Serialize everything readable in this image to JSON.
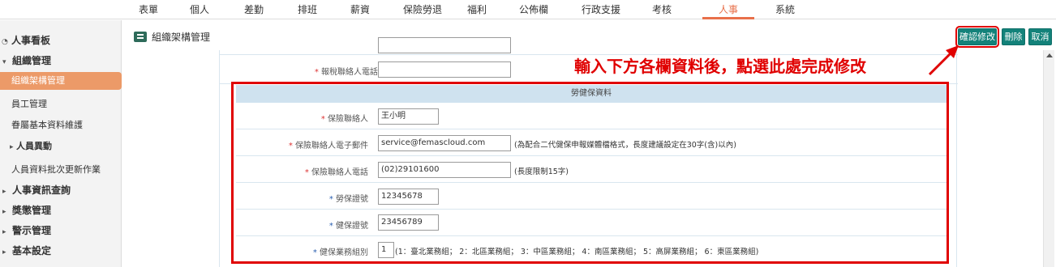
{
  "topnav": {
    "items": [
      "表單",
      "個人",
      "差勤",
      "排班",
      "薪資",
      "保險勞退",
      "福利",
      "公佈欄",
      "行政支援",
      "考核",
      "人事",
      "系統"
    ],
    "active": "人事"
  },
  "sidebar": {
    "hr_board": "人事看板",
    "org_manage": "組織管理",
    "org_structure": "組織架構管理",
    "employee_manage": "員工管理",
    "dependent_maintain": "眷屬基本資料維護",
    "personnel_change": "人員異動",
    "batch_update": "人員資料批次更新作業",
    "hr_query": "人事資訊查詢",
    "reward_punish": "獎懲管理",
    "alert_manage": "警示管理",
    "basic_settings": "基本設定"
  },
  "header": {
    "title": "組織架構管理",
    "confirm_label": "確認修改",
    "delete_label": "刪除",
    "cancel_label": "取消"
  },
  "annotation": "輸入下方各欄資料後，點選此處完成修改",
  "form": {
    "tax_contact_phone_label": "報稅聯絡人電話",
    "tax_contact_phone_value": "",
    "section_title": "勞健保資料",
    "ins_contact_label": "保險聯絡人",
    "ins_contact_value": "王小明",
    "ins_email_label": "保險聯絡人電子郵件",
    "ins_email_value": "service@femascloud.com",
    "ins_email_note": "(為配合二代健保申報媒體檔格式，長度建議設定在30字(含)以內)",
    "ins_phone_label": "保險聯絡人電話",
    "ins_phone_value": "(02)29101600",
    "ins_phone_note": "(長度限制15字)",
    "labor_ins_no_label": "勞保證號",
    "labor_ins_no_value": "12345678",
    "health_ins_no_label": "健保證號",
    "health_ins_no_value": "23456789",
    "health_group_label": "健保業務組別",
    "health_group_value": "1",
    "health_group_note": "(1：臺北業務組； 2：北區業務組； 3：中區業務組； 4：南區業務組； 5：高屏業務組； 6：東區業務組)"
  },
  "colors": {
    "accent": "#e8704a",
    "button": "#13827a",
    "highlight_red": "#e00000",
    "section_bg": "#cfe2ef"
  }
}
